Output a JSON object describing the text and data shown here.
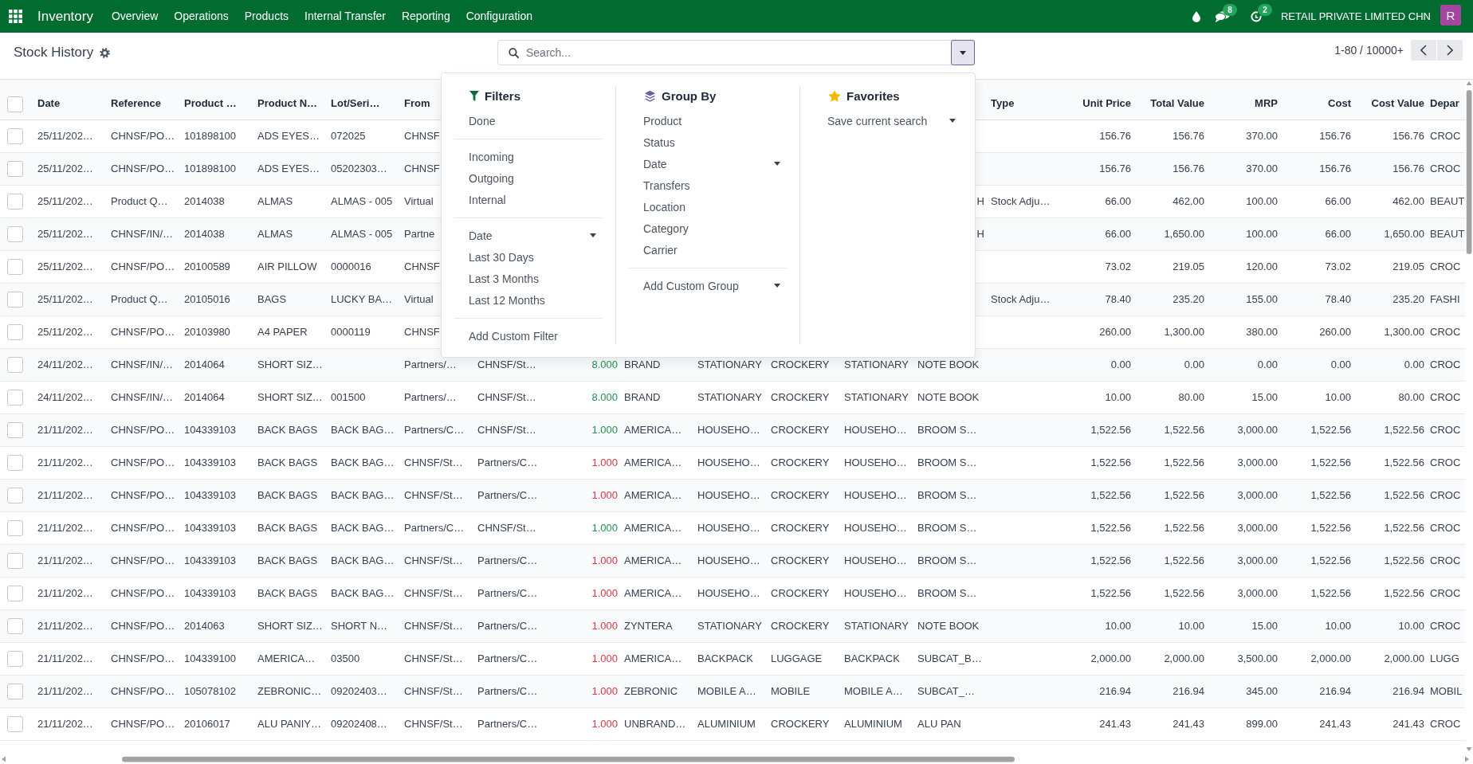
{
  "navbar": {
    "app_name": "Inventory",
    "menu": [
      "Overview",
      "Operations",
      "Products",
      "Internal Transfer",
      "Reporting",
      "Configuration"
    ],
    "messages_badge": "8",
    "activities_badge": "2",
    "company": "RETAIL PRIVATE LIMITED CHN",
    "avatar_letter": "R"
  },
  "control_panel": {
    "title": "Stock History",
    "search": {
      "placeholder": "Search..."
    },
    "pager": "1-80 / 10000+"
  },
  "filter_panel": {
    "open": true,
    "sections": [
      {
        "kind": "filters",
        "title": "Filters",
        "groups": [
          [
            {
              "label": "Done",
              "kind": "option",
              "selected": false
            }
          ],
          [
            {
              "label": "Incoming",
              "kind": "option",
              "selected": false
            },
            {
              "label": "Outgoing",
              "kind": "option",
              "selected": false
            },
            {
              "label": "Internal",
              "kind": "option",
              "selected": false
            }
          ],
          [
            {
              "label": "Date",
              "kind": "submenu"
            },
            {
              "label": "Last 30 Days",
              "kind": "option",
              "selected": false
            },
            {
              "label": "Last 3 Months",
              "kind": "option",
              "selected": false
            },
            {
              "label": "Last 12 Months",
              "kind": "option",
              "selected": false
            }
          ],
          [
            {
              "label": "Add Custom Filter",
              "kind": "action"
            }
          ]
        ]
      },
      {
        "kind": "group_by",
        "title": "Group By",
        "groups": [
          [
            {
              "label": "Product",
              "kind": "option",
              "selected": false
            },
            {
              "label": "Status",
              "kind": "option",
              "selected": false
            },
            {
              "label": "Date",
              "kind": "submenu"
            },
            {
              "label": "Transfers",
              "kind": "option",
              "selected": false
            },
            {
              "label": "Location",
              "kind": "option",
              "selected": false
            },
            {
              "label": "Category",
              "kind": "option",
              "selected": false
            },
            {
              "label": "Carrier",
              "kind": "option",
              "selected": false
            }
          ],
          [
            {
              "label": "Add Custom Group",
              "kind": "submenu"
            }
          ]
        ]
      },
      {
        "kind": "favorites",
        "title": "Favorites",
        "groups": [
          [
            {
              "label": "Save current search",
              "kind": "submenu"
            }
          ]
        ]
      }
    ]
  },
  "table": {
    "select_all": false,
    "columns": [
      {
        "label": "Date",
        "kind": "text"
      },
      {
        "label": "Reference",
        "kind": "text"
      },
      {
        "label": "Product …",
        "kind": "text"
      },
      {
        "label": "Product N…",
        "kind": "text"
      },
      {
        "label": "Lot/Seri…",
        "kind": "text"
      },
      {
        "label": "From",
        "kind": "text"
      },
      {
        "kind": "text"
      },
      {
        "kind": "colored"
      },
      {
        "kind": "text"
      },
      {
        "kind": "text"
      },
      {
        "kind": "text"
      },
      {
        "kind": "text"
      },
      {
        "kind": "text"
      },
      {
        "label": "Type",
        "kind": "text"
      },
      {
        "label": "Unit Price",
        "kind": "number"
      },
      {
        "label": "Total Value",
        "kind": "number"
      },
      {
        "label": "MRP",
        "kind": "number"
      },
      {
        "label": "Cost",
        "kind": "number"
      },
      {
        "label": "Cost Value",
        "kind": "number"
      },
      {
        "label": "Depar",
        "kind": "text"
      }
    ],
    "rows": [
      {
        "checked": false,
        "cells": {
          "column_1": "25/11/202…",
          "column_2": "CHNSF/PO…",
          "column_3": "101898100",
          "column_4": "ADS EYES…",
          "column_5": "072025",
          "column_6": "CHNSF",
          "column_15": "156.76",
          "column_16": "156.76",
          "column_17": "370.00",
          "column_18": "156.76",
          "column_19": "156.76",
          "column_20": "CROC"
        }
      },
      {
        "checked": false,
        "cells": {
          "column_1": "25/11/202…",
          "column_2": "CHNSF/PO…",
          "column_3": "101898100",
          "column_4": "ADS EYES…",
          "column_5": "05202303…",
          "column_6": "CHNSF",
          "column_15": "156.76",
          "column_16": "156.76",
          "column_17": "370.00",
          "column_18": "156.76",
          "column_19": "156.76",
          "column_20": "CROC"
        }
      },
      {
        "checked": false,
        "cells": {
          "column_1": "25/11/202…",
          "column_2": "Product Q…",
          "column_3": "2014038",
          "column_4": "ALMAS",
          "column_5": "ALMAS - 005",
          "column_6": "Virtual",
          "column_13": {
            "text": "H",
            "kind": "tail"
          },
          "column_14": "Stock Adju…",
          "column_15": "66.00",
          "column_16": "462.00",
          "column_17": "100.00",
          "column_18": "66.00",
          "column_19": "462.00",
          "column_20": "BEAUT"
        }
      },
      {
        "checked": false,
        "cells": {
          "column_1": "25/11/202…",
          "column_2": "CHNSF/IN/…",
          "column_3": "2014038",
          "column_4": "ALMAS",
          "column_5": "ALMAS - 005",
          "column_6": "Partne",
          "column_13": {
            "text": "H",
            "kind": "tail"
          },
          "column_15": "66.00",
          "column_16": "1,650.00",
          "column_17": "100.00",
          "column_18": "66.00",
          "column_19": "1,650.00",
          "column_20": "BEAUT"
        }
      },
      {
        "checked": false,
        "cells": {
          "column_1": "25/11/202…",
          "column_2": "CHNSF/PO…",
          "column_3": "20100589",
          "column_4": "AIR PILLOW",
          "column_5": "0000016",
          "column_6": "CHNSF",
          "column_15": "73.02",
          "column_16": "219.05",
          "column_17": "120.00",
          "column_18": "73.02",
          "column_19": "219.05",
          "column_20": "CROC"
        }
      },
      {
        "checked": false,
        "cells": {
          "column_1": "25/11/202…",
          "column_2": "Product Q…",
          "column_3": "20105016",
          "column_4": "BAGS",
          "column_5": "LUCKY BA…",
          "column_6": "Virtual",
          "column_14": "Stock Adju…",
          "column_15": "78.40",
          "column_16": "235.20",
          "column_17": "155.00",
          "column_18": "78.40",
          "column_19": "235.20",
          "column_20": "FASHI"
        }
      },
      {
        "checked": false,
        "cells": {
          "column_1": "25/11/202…",
          "column_2": "CHNSF/PO…",
          "column_3": "20103980",
          "column_4": "A4 PAPER",
          "column_5": "0000119",
          "column_6": "CHNSF",
          "column_15": "260.00",
          "column_16": "1,300.00",
          "column_17": "380.00",
          "column_18": "260.00",
          "column_19": "1,300.00",
          "column_20": "CROC"
        }
      },
      {
        "checked": false,
        "color": "#259052",
        "cells": {
          "column_1": "24/11/202…",
          "column_2": "CHNSF/IN/…",
          "column_3": "2014064",
          "column_4": "SHORT SIZ…",
          "column_6": "Partners/…",
          "column_7": "CHNSF/St…",
          "column_8": "8.000",
          "column_9": "BRAND",
          "column_10": "STATIONARY",
          "column_11": "CROCKERY",
          "column_12": "STATIONARY",
          "column_13": "NOTE BOOK",
          "column_15": "0.00",
          "column_16": "0.00",
          "column_17": "0.00",
          "column_18": "0.00",
          "column_19": "0.00",
          "column_20": "CROC"
        }
      },
      {
        "checked": false,
        "color": "#259052",
        "cells": {
          "column_1": "24/11/202…",
          "column_2": "CHNSF/IN/…",
          "column_3": "2014064",
          "column_4": "SHORT SIZ…",
          "column_5": "001500",
          "column_6": "Partners/…",
          "column_7": "CHNSF/St…",
          "column_8": "8.000",
          "column_9": "BRAND",
          "column_10": "STATIONARY",
          "column_11": "CROCKERY",
          "column_12": "STATIONARY",
          "column_13": "NOTE BOOK",
          "column_15": "10.00",
          "column_16": "80.00",
          "column_17": "15.00",
          "column_18": "10.00",
          "column_19": "80.00",
          "column_20": "CROC"
        }
      },
      {
        "checked": false,
        "color": "#259052",
        "cells": {
          "column_1": "21/11/202…",
          "column_2": "CHNSF/PO…",
          "column_3": "104339103",
          "column_4": "BACK BAGS",
          "column_5": "BACK BAG…",
          "column_6": "Partners/C…",
          "column_7": "CHNSF/St…",
          "column_8": "1.000",
          "column_9": "AMERICA…",
          "column_10": "HOUSEHO…",
          "column_11": "CROCKERY",
          "column_12": "HOUSEHO…",
          "column_13": "BROOM S…",
          "column_15": "1,522.56",
          "column_16": "1,522.56",
          "column_17": "3,000.00",
          "column_18": "1,522.56",
          "column_19": "1,522.56",
          "column_20": "CROC"
        }
      },
      {
        "checked": false,
        "color": "#dc3545",
        "cells": {
          "column_1": "21/11/202…",
          "column_2": "CHNSF/PO…",
          "column_3": "104339103",
          "column_4": "BACK BAGS",
          "column_5": "BACK BAG…",
          "column_6": "CHNSF/St…",
          "column_7": "Partners/C…",
          "column_8": "1.000",
          "column_9": "AMERICA…",
          "column_10": "HOUSEHO…",
          "column_11": "CROCKERY",
          "column_12": "HOUSEHO…",
          "column_13": "BROOM S…",
          "column_15": "1,522.56",
          "column_16": "1,522.56",
          "column_17": "3,000.00",
          "column_18": "1,522.56",
          "column_19": "1,522.56",
          "column_20": "CROC"
        }
      },
      {
        "checked": false,
        "color": "#dc3545",
        "cells": {
          "column_1": "21/11/202…",
          "column_2": "CHNSF/PO…",
          "column_3": "104339103",
          "column_4": "BACK BAGS",
          "column_5": "BACK BAG…",
          "column_6": "CHNSF/St…",
          "column_7": "Partners/C…",
          "column_8": "1.000",
          "column_9": "AMERICA…",
          "column_10": "HOUSEHO…",
          "column_11": "CROCKERY",
          "column_12": "HOUSEHO…",
          "column_13": "BROOM S…",
          "column_15": "1,522.56",
          "column_16": "1,522.56",
          "column_17": "3,000.00",
          "column_18": "1,522.56",
          "column_19": "1,522.56",
          "column_20": "CROC"
        }
      },
      {
        "checked": false,
        "color": "#259052",
        "cells": {
          "column_1": "21/11/202…",
          "column_2": "CHNSF/PO…",
          "column_3": "104339103",
          "column_4": "BACK BAGS",
          "column_5": "BACK BAG…",
          "column_6": "Partners/C…",
          "column_7": "CHNSF/St…",
          "column_8": "1.000",
          "column_9": "AMERICA…",
          "column_10": "HOUSEHO…",
          "column_11": "CROCKERY",
          "column_12": "HOUSEHO…",
          "column_13": "BROOM S…",
          "column_15": "1,522.56",
          "column_16": "1,522.56",
          "column_17": "3,000.00",
          "column_18": "1,522.56",
          "column_19": "1,522.56",
          "column_20": "CROC"
        }
      },
      {
        "checked": false,
        "color": "#dc3545",
        "cells": {
          "column_1": "21/11/202…",
          "column_2": "CHNSF/PO…",
          "column_3": "104339103",
          "column_4": "BACK BAGS",
          "column_5": "BACK BAG…",
          "column_6": "CHNSF/St…",
          "column_7": "Partners/C…",
          "column_8": "1.000",
          "column_9": "AMERICA…",
          "column_10": "HOUSEHO…",
          "column_11": "CROCKERY",
          "column_12": "HOUSEHO…",
          "column_13": "BROOM S…",
          "column_15": "1,522.56",
          "column_16": "1,522.56",
          "column_17": "3,000.00",
          "column_18": "1,522.56",
          "column_19": "1,522.56",
          "column_20": "CROC"
        }
      },
      {
        "checked": false,
        "color": "#dc3545",
        "cells": {
          "column_1": "21/11/202…",
          "column_2": "CHNSF/PO…",
          "column_3": "104339103",
          "column_4": "BACK BAGS",
          "column_5": "BACK BAG…",
          "column_6": "CHNSF/St…",
          "column_7": "Partners/C…",
          "column_8": "1.000",
          "column_9": "AMERICA…",
          "column_10": "HOUSEHO…",
          "column_11": "CROCKERY",
          "column_12": "HOUSEHO…",
          "column_13": "BROOM S…",
          "column_15": "1,522.56",
          "column_16": "1,522.56",
          "column_17": "3,000.00",
          "column_18": "1,522.56",
          "column_19": "1,522.56",
          "column_20": "CROC"
        }
      },
      {
        "checked": false,
        "color": "#dc3545",
        "cells": {
          "column_1": "21/11/202…",
          "column_2": "CHNSF/PO…",
          "column_3": "2014063",
          "column_4": "SHORT SIZ…",
          "column_5": "SHORT N…",
          "column_6": "CHNSF/St…",
          "column_7": "Partners/C…",
          "column_8": "1.000",
          "column_9": "ZYNTERA",
          "column_10": "STATIONARY",
          "column_11": "CROCKERY",
          "column_12": "STATIONARY",
          "column_13": "NOTE BOOK",
          "column_15": "10.00",
          "column_16": "10.00",
          "column_17": "15.00",
          "column_18": "10.00",
          "column_19": "10.00",
          "column_20": "CROC"
        }
      },
      {
        "checked": false,
        "color": "#dc3545",
        "cells": {
          "column_1": "21/11/202…",
          "column_2": "CHNSF/PO…",
          "column_3": "104339100",
          "column_4": "AMERICA…",
          "column_5": "03500",
          "column_6": "CHNSF/St…",
          "column_7": "Partners/C…",
          "column_8": "1.000",
          "column_9": "AMERICA…",
          "column_10": "BACKPACK",
          "column_11": "LUGGAGE",
          "column_12": "BACKPACK",
          "column_13": "SUBCAT_B…",
          "column_15": "2,000.00",
          "column_16": "2,000.00",
          "column_17": "3,500.00",
          "column_18": "2,000.00",
          "column_19": "2,000.00",
          "column_20": "LUGG"
        }
      },
      {
        "checked": false,
        "color": "#dc3545",
        "cells": {
          "column_1": "21/11/202…",
          "column_2": "CHNSF/PO…",
          "column_3": "105078102",
          "column_4": "ZEBRONIC…",
          "column_5": "09202403…",
          "column_6": "CHNSF/St…",
          "column_7": "Partners/C…",
          "column_8": "1.000",
          "column_9": "ZEBRONIC",
          "column_10": "MOBILE A…",
          "column_11": "MOBILE",
          "column_12": "MOBILE A…",
          "column_13": "SUBCAT_…",
          "column_15": "216.94",
          "column_16": "216.94",
          "column_17": "345.00",
          "column_18": "216.94",
          "column_19": "216.94",
          "column_20": "MOBIL"
        }
      },
      {
        "checked": false,
        "color": "#dc3545",
        "cells": {
          "column_1": "21/11/202…",
          "column_2": "CHNSF/PO…",
          "column_3": "20106017",
          "column_4": "ALU PANIY…",
          "column_5": "09202408…",
          "column_6": "CHNSF/St…",
          "column_7": "Partners/C…",
          "column_8": "1.000",
          "column_9": "UNBRAND…",
          "column_10": "ALUMINIUM",
          "column_11": "CROCKERY",
          "column_12": "ALUMINIUM",
          "column_13": "ALU PAN",
          "column_15": "241.43",
          "column_16": "241.43",
          "column_17": "899.00",
          "column_18": "241.43",
          "column_19": "241.43",
          "column_20": "CROC"
        }
      }
    ]
  }
}
